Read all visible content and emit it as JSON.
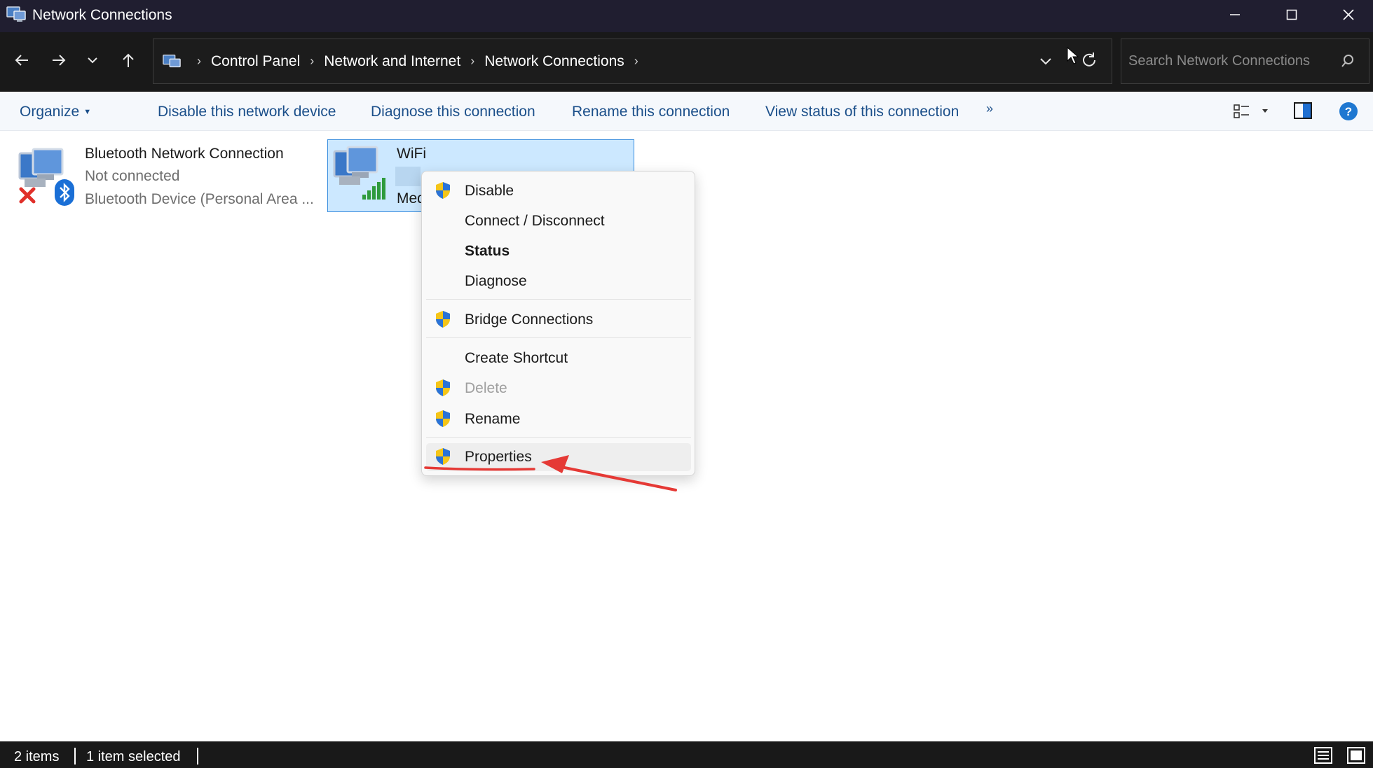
{
  "window": {
    "title": "Network Connections"
  },
  "address": {
    "breadcrumbs": [
      "Control Panel",
      "Network and Internet",
      "Network Connections"
    ]
  },
  "search": {
    "placeholder": "Search Network Connections"
  },
  "commands": {
    "organize": "Organize",
    "disable": "Disable this network device",
    "diagnose": "Diagnose this connection",
    "rename": "Rename this connection",
    "view_status": "View status of this connection",
    "more": "»"
  },
  "items": [
    {
      "name": "Bluetooth Network Connection",
      "status": "Not connected",
      "device": "Bluetooth Device (Personal Area ..."
    },
    {
      "name": "WiFi",
      "device": "Med"
    }
  ],
  "context_menu": {
    "items": [
      {
        "label": "Disable",
        "shield": true
      },
      {
        "label": "Connect / Disconnect",
        "shield": false
      },
      {
        "label": "Status",
        "shield": false,
        "bold": true
      },
      {
        "label": "Diagnose",
        "shield": false
      },
      {
        "label": "Bridge Connections",
        "shield": true
      },
      {
        "label": "Create Shortcut",
        "shield": false
      },
      {
        "label": "Delete",
        "shield": true,
        "disabled": true
      },
      {
        "label": "Rename",
        "shield": true
      },
      {
        "label": "Properties",
        "shield": true,
        "highlighted": true
      }
    ]
  },
  "status_bar": {
    "count": "2 items",
    "selected": "1 item selected"
  },
  "colors": {
    "titlebar": "#201e30",
    "toolbar": "#191919",
    "command_text": "#1b4f8a",
    "selection": "#cce8ff",
    "selection_border": "#3b8ede",
    "annotation": "#e53935"
  },
  "icons": [
    "network-connections-icon",
    "back-icon",
    "forward-icon",
    "recent-icon",
    "up-icon",
    "chevron-down-icon",
    "refresh-icon",
    "search-icon",
    "layout-icon",
    "preview-pane-icon",
    "help-icon",
    "shield-icon",
    "bluetooth-icon",
    "wifi-signal-icon",
    "disconnected-x-icon",
    "details-view-icon",
    "large-icons-view-icon"
  ]
}
